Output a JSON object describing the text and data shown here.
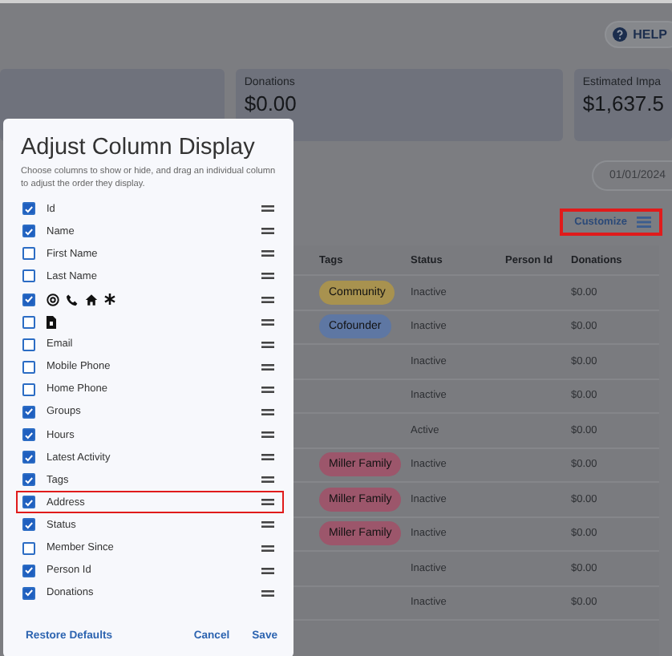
{
  "header": {
    "help_label": "HELP"
  },
  "stats": [
    {
      "label": "Donations",
      "value": "$0.00"
    },
    {
      "label": "Estimated Impa",
      "value": "$1,637.5"
    }
  ],
  "date_field": {
    "value": "01/01/2024"
  },
  "customize_button": {
    "label": "Customize",
    "highlighted": true
  },
  "table": {
    "columns": [
      "Tags",
      "Status",
      "Person Id",
      "Donations"
    ],
    "rows": [
      {
        "tag": {
          "label": "Community",
          "color": "#a8924f"
        },
        "status": "Inactive",
        "donations": "$0.00"
      },
      {
        "tag": {
          "label": "Cofounder",
          "color": "#5e77a3"
        },
        "status": "Inactive",
        "donations": "$0.00"
      },
      {
        "status": "Inactive",
        "donations": "$0.00"
      },
      {
        "status": "Inactive",
        "donations": "$0.00"
      },
      {
        "status": "Active",
        "donations": "$0.00"
      },
      {
        "tag": {
          "label": "Miller Family",
          "color": "#9c566b"
        },
        "status": "Inactive",
        "donations": "$0.00"
      },
      {
        "tag": {
          "label": "Miller Family",
          "color": "#9c566b"
        },
        "status": "Inactive",
        "donations": "$0.00"
      },
      {
        "tag": {
          "label": "Miller Family",
          "color": "#9c566b"
        },
        "status": "Inactive",
        "donations": "$0.00"
      },
      {
        "status": "Inactive",
        "donations": "$0.00"
      },
      {
        "status": "Inactive",
        "donations": "$0.00"
      }
    ]
  },
  "dialog": {
    "title": "Adjust Column Display",
    "description": "Choose columns to show or hide, and drag an individual column to adjust the order they display.",
    "columns": [
      {
        "kind": "text",
        "label": "Id",
        "checked": true,
        "highlighted": false
      },
      {
        "kind": "text",
        "label": "Name",
        "checked": true,
        "highlighted": false
      },
      {
        "kind": "text",
        "label": "First Name",
        "checked": false,
        "highlighted": false
      },
      {
        "kind": "text",
        "label": "Last Name",
        "checked": false,
        "highlighted": false
      },
      {
        "kind": "contact-icons",
        "checked": true,
        "highlighted": false
      },
      {
        "kind": "document-icon",
        "checked": false,
        "highlighted": false
      },
      {
        "kind": "text",
        "label": "Email",
        "checked": false,
        "highlighted": false
      },
      {
        "kind": "text",
        "label": "Mobile Phone",
        "checked": false,
        "highlighted": false
      },
      {
        "kind": "text",
        "label": "Home Phone",
        "checked": false,
        "highlighted": false
      },
      {
        "kind": "text",
        "label": "Groups",
        "checked": true,
        "highlighted": false
      },
      {
        "kind": "text",
        "label": "Hours",
        "checked": true,
        "highlighted": false
      },
      {
        "kind": "text",
        "label": "Latest Activity",
        "checked": true,
        "highlighted": false
      },
      {
        "kind": "text",
        "label": "Tags",
        "checked": true,
        "highlighted": false
      },
      {
        "kind": "text",
        "label": "Address",
        "checked": true,
        "highlighted": true
      },
      {
        "kind": "text",
        "label": "Status",
        "checked": true,
        "highlighted": false
      },
      {
        "kind": "text",
        "label": "Member Since",
        "checked": false,
        "highlighted": false
      },
      {
        "kind": "text",
        "label": "Person Id",
        "checked": true,
        "highlighted": false
      },
      {
        "kind": "text",
        "label": "Donations",
        "checked": true,
        "highlighted": false
      }
    ],
    "buttons": {
      "restore": "Restore Defaults",
      "cancel": "Cancel",
      "save": "Save"
    }
  }
}
